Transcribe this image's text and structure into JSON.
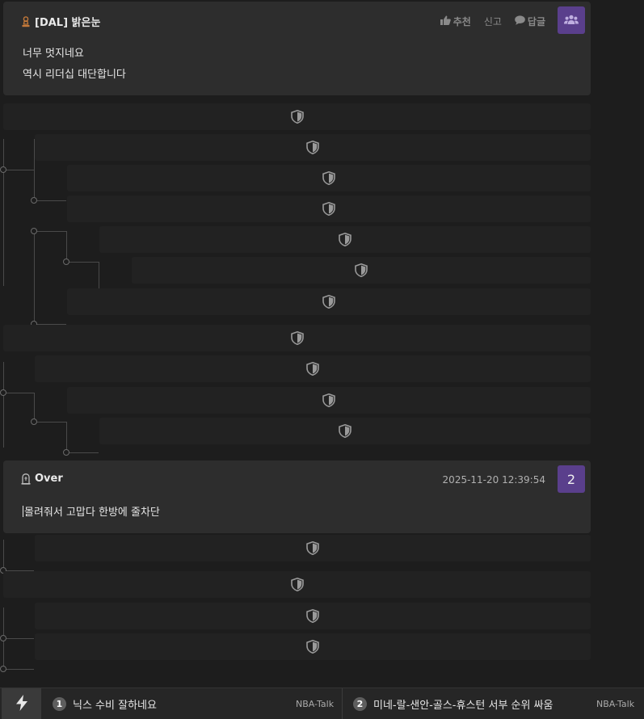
{
  "comments": [
    {
      "author": "[DAL] 밝은눈",
      "author_icon": "chess-pawn-icon",
      "actions": {
        "recommend": "추천",
        "report": "신고",
        "reply": "답글"
      },
      "badge_icon": "users-icon",
      "lines": [
        "너무 멋지네요",
        "역시 리더십 대단합니다"
      ]
    },
    {
      "author": "Over",
      "author_icon": "tombstone-icon",
      "timestamp": "2025-11-20 12:39:54",
      "badge": "2",
      "lines": [
        "몰려줘서 고맙다 한방에 줄차단"
      ]
    }
  ],
  "hidden_reply_icon": "shield-icon",
  "hidden_reply_count": 16,
  "bottom_bar": {
    "bolt_icon": "lightning-icon",
    "items": [
      {
        "num": "1",
        "title": "닉스 수비 잘하네요",
        "category": "NBA-Talk"
      },
      {
        "num": "2",
        "title": "미네-랄-샌안-골스-휴스턴 서부 순위 싸움",
        "category": "NBA-Talk"
      }
    ]
  },
  "colors": {
    "background": "#1d1d1d",
    "card": "#2d2d2d",
    "badge": "#5a3f8c",
    "hidden_row": "#222222"
  }
}
